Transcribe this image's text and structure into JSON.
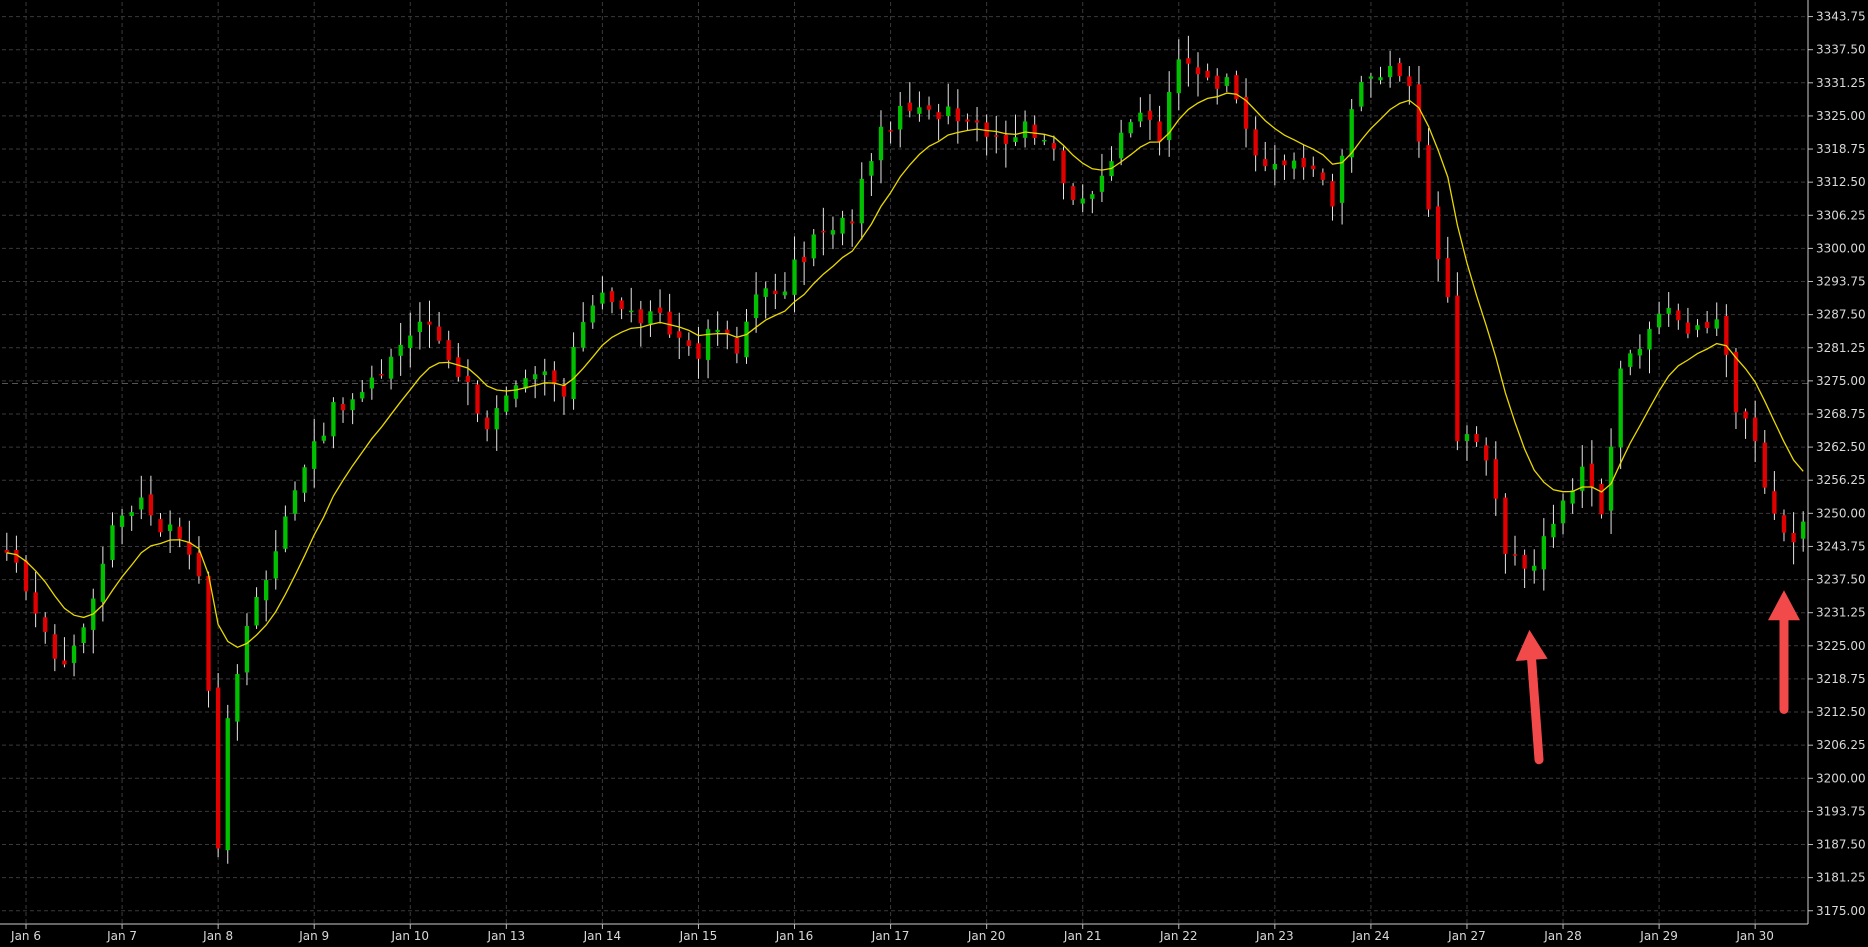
{
  "chart_data": {
    "type": "candlestick",
    "title": "",
    "xlabel": "",
    "ylabel": "",
    "ylim": [
      3172.5,
      3346.5
    ],
    "grid": true,
    "legend": "none",
    "background_color": "#000000",
    "grid_color": "#3a3a3a",
    "up_color": "#00c000",
    "down_color": "#e00000",
    "wick_color": "#e6e6e6",
    "ma_color": "#e8d800",
    "annotation_color": "#f24a4a",
    "y_ticks": [
      "3343.75",
      "3337.50",
      "3331.25",
      "3325.00",
      "3318.75",
      "3312.50",
      "3306.25",
      "3300.00",
      "3293.75",
      "3287.50",
      "3281.25",
      "3275.00",
      "3268.75",
      "3262.50",
      "3256.25",
      "3250.00",
      "3243.75",
      "3237.50",
      "3231.25",
      "3225.00",
      "3218.75",
      "3212.50",
      "3206.25",
      "3200.00",
      "3193.75",
      "3187.50",
      "3181.25",
      "3175.00"
    ],
    "x_ticks": [
      {
        "label": "Jan 6",
        "index": 2
      },
      {
        "label": "Jan 7",
        "index": 12
      },
      {
        "label": "Jan 8",
        "index": 22
      },
      {
        "label": "Jan 9",
        "index": 32
      },
      {
        "label": "Jan 10",
        "index": 42
      },
      {
        "label": "Jan 13",
        "index": 52
      },
      {
        "label": "Jan 14",
        "index": 62
      },
      {
        "label": "Jan 15",
        "index": 72
      },
      {
        "label": "Jan 16",
        "index": 82
      },
      {
        "label": "Jan 17",
        "index": 92
      },
      {
        "label": "Jan 20",
        "index": 102
      },
      {
        "label": "Jan 21",
        "index": 112
      },
      {
        "label": "Jan 22",
        "index": 122
      },
      {
        "label": "Jan 23",
        "index": 132
      },
      {
        "label": "Jan 24",
        "index": 142
      },
      {
        "label": "Jan 27",
        "index": 152
      },
      {
        "label": "Jan 28",
        "index": 162
      },
      {
        "label": "Jan 29",
        "index": 172
      },
      {
        "label": "Jan 30",
        "index": 182
      }
    ],
    "x_count": 188,
    "reference_line": 3274.5,
    "key_points": [
      [
        0,
        3241
      ],
      [
        2,
        3237
      ],
      [
        4,
        3226
      ],
      [
        6,
        3222
      ],
      [
        8,
        3228
      ],
      [
        10,
        3242
      ],
      [
        12,
        3250
      ],
      [
        14,
        3253
      ],
      [
        16,
        3248
      ],
      [
        18,
        3246
      ],
      [
        20,
        3240
      ],
      [
        21,
        3215
      ],
      [
        22,
        3188
      ],
      [
        23,
        3210
      ],
      [
        25,
        3230
      ],
      [
        28,
        3242
      ],
      [
        30,
        3256
      ],
      [
        32,
        3264
      ],
      [
        34,
        3269
      ],
      [
        36,
        3271
      ],
      [
        38,
        3274
      ],
      [
        40,
        3280
      ],
      [
        42,
        3284
      ],
      [
        44,
        3286
      ],
      [
        46,
        3280
      ],
      [
        48,
        3274
      ],
      [
        50,
        3267
      ],
      [
        52,
        3271
      ],
      [
        54,
        3274
      ],
      [
        56,
        3276
      ],
      [
        58,
        3272
      ],
      [
        60,
        3287
      ],
      [
        62,
        3293
      ],
      [
        64,
        3288
      ],
      [
        66,
        3287
      ],
      [
        68,
        3286
      ],
      [
        70,
        3283
      ],
      [
        72,
        3281
      ],
      [
        74,
        3285
      ],
      [
        76,
        3280
      ],
      [
        78,
        3293
      ],
      [
        80,
        3290
      ],
      [
        82,
        3296
      ],
      [
        84,
        3302
      ],
      [
        86,
        3303
      ],
      [
        88,
        3306
      ],
      [
        90,
        3318
      ],
      [
        92,
        3324
      ],
      [
        94,
        3326
      ],
      [
        96,
        3325
      ],
      [
        98,
        3327
      ],
      [
        100,
        3325
      ],
      [
        102,
        3323
      ],
      [
        104,
        3321
      ],
      [
        106,
        3323
      ],
      [
        108,
        3322
      ],
      [
        110,
        3312
      ],
      [
        112,
        3310
      ],
      [
        114,
        3314
      ],
      [
        116,
        3320
      ],
      [
        118,
        3326
      ],
      [
        120,
        3321
      ],
      [
        122,
        3335
      ],
      [
        124,
        3334
      ],
      [
        126,
        3332
      ],
      [
        128,
        3330
      ],
      [
        130,
        3319
      ],
      [
        132,
        3314
      ],
      [
        134,
        3317
      ],
      [
        136,
        3315
      ],
      [
        138,
        3308
      ],
      [
        140,
        3328
      ],
      [
        142,
        3332
      ],
      [
        144,
        3333
      ],
      [
        146,
        3331
      ],
      [
        148,
        3306
      ],
      [
        150,
        3291
      ],
      [
        151,
        3263
      ],
      [
        152,
        3264
      ],
      [
        154,
        3260
      ],
      [
        156,
        3242
      ],
      [
        158,
        3240
      ],
      [
        160,
        3244
      ],
      [
        162,
        3252
      ],
      [
        164,
        3258
      ],
      [
        166,
        3250
      ],
      [
        168,
        3276
      ],
      [
        170,
        3283
      ],
      [
        172,
        3288
      ],
      [
        174,
        3286
      ],
      [
        176,
        3285
      ],
      [
        178,
        3288
      ],
      [
        179,
        3280
      ],
      [
        180,
        3270
      ],
      [
        182,
        3262
      ],
      [
        184,
        3248
      ],
      [
        186,
        3246
      ],
      [
        187,
        3248
      ]
    ],
    "annotations": [
      {
        "type": "arrow",
        "from": [
          159.5,
          3203.5
        ],
        "to": [
          158.5,
          3228
        ]
      },
      {
        "type": "arrow",
        "from": [
          185,
          3213
        ],
        "to": [
          185,
          3235.5
        ]
      }
    ]
  }
}
